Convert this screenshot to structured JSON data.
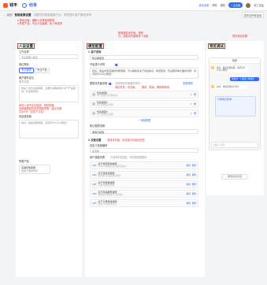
{
  "topbar": {
    "brand_primary": "钱丰",
    "brand_secondary": "纷享",
    "nav_items": [
      "首页设置",
      "帮助",
      "通知"
    ],
    "upgrade_label": "+ 企业版",
    "user_label": "张三总监"
  },
  "subbar": {
    "back_label": "← 返回",
    "title": "智能客服设置",
    "hint": "设置您的智能客服行为，帮您提升客户服务效率",
    "right_button": "发布至所有渠道"
  },
  "annotations": {
    "left_top": "● 角色设置：编辑人设等常用配置",
    "left_top2": "● 所属产品：专业平台客服，私人等选项",
    "mid_top": "配置模型优先级，规则",
    "mid_top2": "与，技能优先级等多个设置",
    "right_top": "预览调试效果",
    "left_mid": "填写人设专业化描述，同时配置",
    "left_mid2": "设置客服回复的范围和界限，建议不超",
    "left_mid3": "过500字（见如下示意）",
    "mid_mid": "调优开关、优先级、",
    "mid_mid2": "顺序、数量、删除和新增",
    "mid_lower": "选择优先级，将流量引向最优回复"
  },
  "left_panel": {
    "title": "人设设置",
    "work_label": "工作名称",
    "work_value": "专业客服小助手",
    "role_label": "岗位角色",
    "role_options": [
      "专业客服",
      "专业产品"
    ],
    "role_selected": "专业客服",
    "desc_label": "客户服务定位",
    "desc_sub": "服务范围",
    "desc_placeholder": "你是一名专业的客服，主要负责解答用户关于产品使用、售后等问题...",
    "welcome_label": "欢迎语设置",
    "welcome_placeholder": "你好，我是智能客服，请问有什么可以帮您？",
    "product_label": "所属产品",
    "product_value": "店铺智能客服",
    "product_sub": "适用于电商场景"
  },
  "mid_panel": {
    "title": "模型配置",
    "section1": "1. 客户咨询",
    "field1_label": "知识库配置",
    "field1_value": "知识库配置",
    "switch_label": "开启语义识别",
    "intro_text": "您好，我是这家店铺的智能客服，可以解答您关于商品信息、物流配送、售后服务等方面的问题，请问有什么可以帮您？",
    "priority_label": "模型优先级设置",
    "priority_hint": "请按照优先级顺序排列",
    "rules_link": "查看规则",
    "models": [
      {
        "name": "优先模型1",
        "desc": "用于处理常见问题咨询"
      },
      {
        "name": "优先模型2",
        "desc": "用于处理复杂问题"
      },
      {
        "name": "优先模型3",
        "desc": "用于处理售后问题"
      }
    ],
    "add_model": "+ 添加模型",
    "fallback_label": "默认模型设置",
    "fallback_value": "通用大模型",
    "section2": "2. 技能设置",
    "skill_select_label": "自定义技能编排",
    "skill_select_value": "请选择",
    "skill_list_label": "用户技能列表",
    "skill_list_hint": "已选择5项技能，可拖拽调整顺序",
    "skills": [
      {
        "tag": "ADD",
        "name": "关于物流查询技能",
        "desc": "查询订单物流信息并返回给客户"
      },
      {
        "tag": "ADD",
        "name": "关于退换货技能",
        "desc": "处理客户的退货换货申请"
      },
      {
        "tag": "ADD",
        "name": "关于优惠券技能",
        "desc": "为客户发放优惠券"
      },
      {
        "tag": "ADD",
        "name": "关于商品推荐技能",
        "desc": "根据客户需求推荐合适商品"
      },
      {
        "tag": "ADD",
        "name": "关于订单修改技能",
        "desc": "修改订单地址等信息"
      }
    ],
    "skill_actions": [
      "编辑",
      "删除"
    ]
  },
  "right_panel": {
    "title": "预览调试",
    "chat_title": "预览",
    "messages": [
      "您好，我是智能客服，请问有什么可以帮您？",
      "我想查一下我的订单物流",
      "好的，请提供您的订单号"
    ],
    "card_title": "订单信息查询",
    "input_placeholder": "请输入问题",
    "reset_label": "重置调试对话"
  },
  "colors": {
    "accent": "#2f6bff",
    "annotation": "#e53935",
    "brand": "#ff5a1f"
  }
}
